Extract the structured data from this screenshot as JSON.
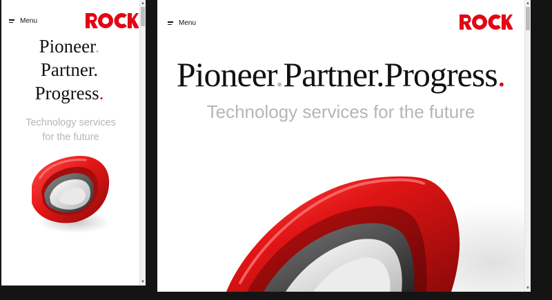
{
  "mobile": {
    "menu_label": "Menu",
    "logo_alt": "ROCK",
    "headline_lines": [
      {
        "word": "Pioneer",
        "dot": "."
      },
      {
        "word": "Partner",
        "dot": "."
      },
      {
        "word": "Progress",
        "dot": "."
      }
    ],
    "tagline_line1": "Technology services",
    "tagline_line2": "for the future"
  },
  "desktop": {
    "menu_label": "Menu",
    "logo_alt": "ROCK",
    "headline": [
      {
        "word": "Pioneer",
        "dot": "."
      },
      {
        "word": "Partner",
        "dot": "."
      },
      {
        "word": "Progress",
        "dot": "."
      }
    ],
    "tagline": "Technology services for the future"
  },
  "colors": {
    "brand_red": "#e30613",
    "text": "#111111",
    "tagline": "#b6b6b6",
    "background": "#ffffff",
    "page_backdrop": "#141414"
  },
  "icons": {
    "menu": "hamburger-icon",
    "logo": "rock-logo",
    "hero": "red-ring-sculpture"
  }
}
